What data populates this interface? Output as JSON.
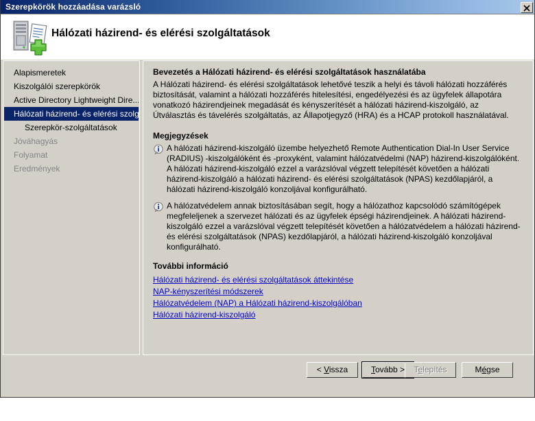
{
  "window": {
    "title": "Szerepkörök hozzáadása varázsló",
    "close_label": "×",
    "close_icon": "close-icon"
  },
  "header": {
    "title": "Hálózati házirend- és elérési szolgáltatások",
    "icon": "server-role-add-icon"
  },
  "sidebar": {
    "items": [
      {
        "label": "Alapismeretek",
        "state": "normal",
        "level": 0
      },
      {
        "label": "Kiszolgálói szerepkörök",
        "state": "normal",
        "level": 0
      },
      {
        "label": "Active Directory Lightweight Dire...",
        "state": "normal",
        "level": 0
      },
      {
        "label": "Hálózati házirend- és elérési szolg...",
        "state": "selected",
        "level": 0
      },
      {
        "label": "Szerepkör-szolgáltatások",
        "state": "normal",
        "level": 1
      },
      {
        "label": "Jóváhagyás",
        "state": "disabled",
        "level": 0
      },
      {
        "label": "Folyamat",
        "state": "disabled",
        "level": 0
      },
      {
        "label": "Eredmények",
        "state": "disabled",
        "level": 0
      }
    ]
  },
  "content": {
    "intro_heading": "Bevezetés a Hálózati házirend- és elérési szolgáltatások használatába",
    "intro_body": "A Hálózati házirend- és elérési szolgáltatások lehetővé teszik a helyi és távoli hálózati hozzáférés biztosítását, valamint a hálózati hozzáférés hitelesítési, engedélyezési és az ügyfelek állapotára vonatkozó házirendjeinek megadását és kényszerítését a hálózati házirend-kiszolgáló, az Útválasztás és távelérés szolgáltatás, az Állapotjegyző (HRA) és a HCAP protokoll használatával.",
    "notes_heading": "Megjegyzések",
    "notes": [
      {
        "icon": "info-icon",
        "text": "A hálózati házirend-kiszolgáló üzembe helyezhető Remote Authentication Dial-In User Service (RADIUS) -kiszolgálóként és -proxyként, valamint hálózatvédelmi (NAP) házirend-kiszolgálóként. A hálózati házirend-kiszolgáló ezzel a varázslóval végzett telepítését követően a hálózati házirend-kiszolgáló a hálózati házirend- és elérési szolgáltatások (NPAS) kezdőlapjáról, a hálózati házirend-kiszolgáló konzoljával konfigurálható."
      },
      {
        "icon": "info-icon",
        "text": "A hálózatvédelem annak biztosításában segít, hogy a hálózathoz kapcsolódó számítógépek megfeleljenek a szervezet hálózati és az ügyfelek épségi házirendjeinek. A hálózati házirend-kiszolgáló ezzel a varázslóval végzett telepítését követően a hálózatvédelem a hálózati házirend- és elérési szolgáltatások (NPAS) kezdőlapjáról, a hálózati házirend-kiszolgáló konzoljával konfigurálható."
      }
    ],
    "more_info_heading": "További információ",
    "links": [
      "Hálózati házirend- és elérési szolgáltatások áttekintése",
      "NAP-kényszerítési módszerek",
      "Hálózatvédelem (NAP) a Hálózati házirend-kiszolgálóban",
      "Hálózati házirend-kiszolgáló"
    ]
  },
  "footer": {
    "back": {
      "prefix": "< ",
      "accel": "V",
      "suffix": "issza",
      "state": "enabled"
    },
    "next": {
      "prefix": "",
      "accel": "T",
      "suffix": "ovább >",
      "state": "default"
    },
    "install": {
      "prefix": "T",
      "accel": "e",
      "suffix": "lepítés",
      "state": "disabled"
    },
    "cancel": {
      "prefix": "M",
      "accel": "é",
      "suffix": "gse",
      "state": "enabled"
    }
  },
  "colors": {
    "face": "#d4d0c8",
    "title_start": "#0a246a",
    "title_end": "#a9c8ea",
    "selection": "#0a246a",
    "link": "#0000cd",
    "disabled_text": "#848484"
  }
}
